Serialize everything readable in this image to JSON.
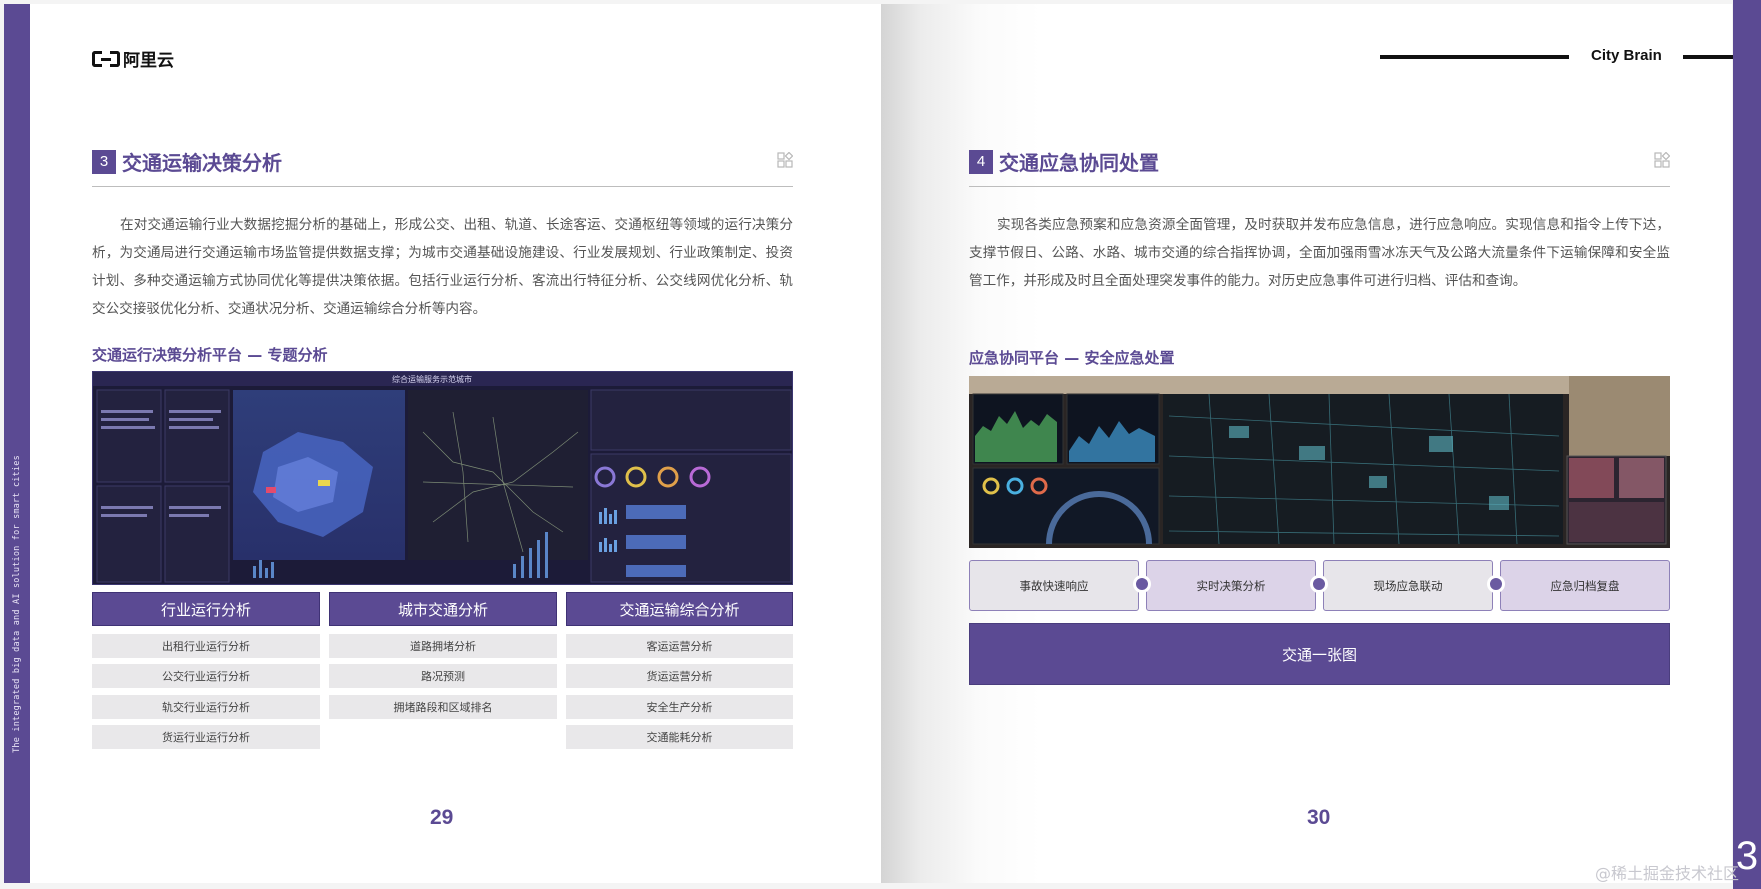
{
  "brand": {
    "logo_text": "阿里云",
    "product": "City Brain"
  },
  "side_caption": "The integrated big data and AI solution for smart cities",
  "left": {
    "section_number": "3",
    "section_title": "交通运输决策分析",
    "paragraph": "在对交通运输行业大数据挖掘分析的基础上，形成公交、出租、轨道、长途客运、交通枢纽等领域的运行决策分析，为交通局进行交通运输市场监管提供数据支撑；为城市交通基础设施建设、行业发展规划、行业政策制定、投资计划、多种交通运输方式协同优化等提供决策依据。包括行业运行分析、客流出行特征分析、公交线网优化分析、轨交公交接驳优化分析、交通状况分析、交通运输综合分析等内容。",
    "platform_title": "交通运行决策分析平台 — 专题分析",
    "dashboard_title": "综合运输服务示范城市",
    "categories": [
      {
        "title": "行业运行分析",
        "items": [
          "出租行业运行分析",
          "公交行业运行分析",
          "轨交行业运行分析",
          "货运行业运行分析"
        ]
      },
      {
        "title": "城市交通分析",
        "items": [
          "道路拥堵分析",
          "路况预测",
          "拥堵路段和区域排名"
        ]
      },
      {
        "title": "交通运输综合分析",
        "items": [
          "客运运营分析",
          "货运运营分析",
          "安全生产分析",
          "交通能耗分析"
        ]
      }
    ],
    "page_number": "29"
  },
  "right": {
    "section_number": "4",
    "section_title": "交通应急协同处置",
    "paragraph": "实现各类应急预案和应急资源全面管理，及时获取并发布应急信息，进行应急响应。实现信息和指令上传下达，支撑节假日、公路、水路、城市交通的综合指挥协调，全面加强雨雪冰冻天气及公路大流量条件下运输保障和安全监管工作，并形成及时且全面处理突发事件的能力。对历史应急事件可进行归档、评估和查询。",
    "platform_title": "应急协同平台 — 安全应急处置",
    "steps": [
      "事故快速响应",
      "实时决策分析",
      "现场应急联动",
      "应急归档复盘"
    ],
    "map_button": "交通一张图",
    "page_number": "30"
  },
  "corner_number": "3",
  "watermark": "@稀土掘金技术社区",
  "colors": {
    "accent": "#5b4a93",
    "step_light": "#e7e5ea",
    "step_purple": "#dcd3e8"
  }
}
